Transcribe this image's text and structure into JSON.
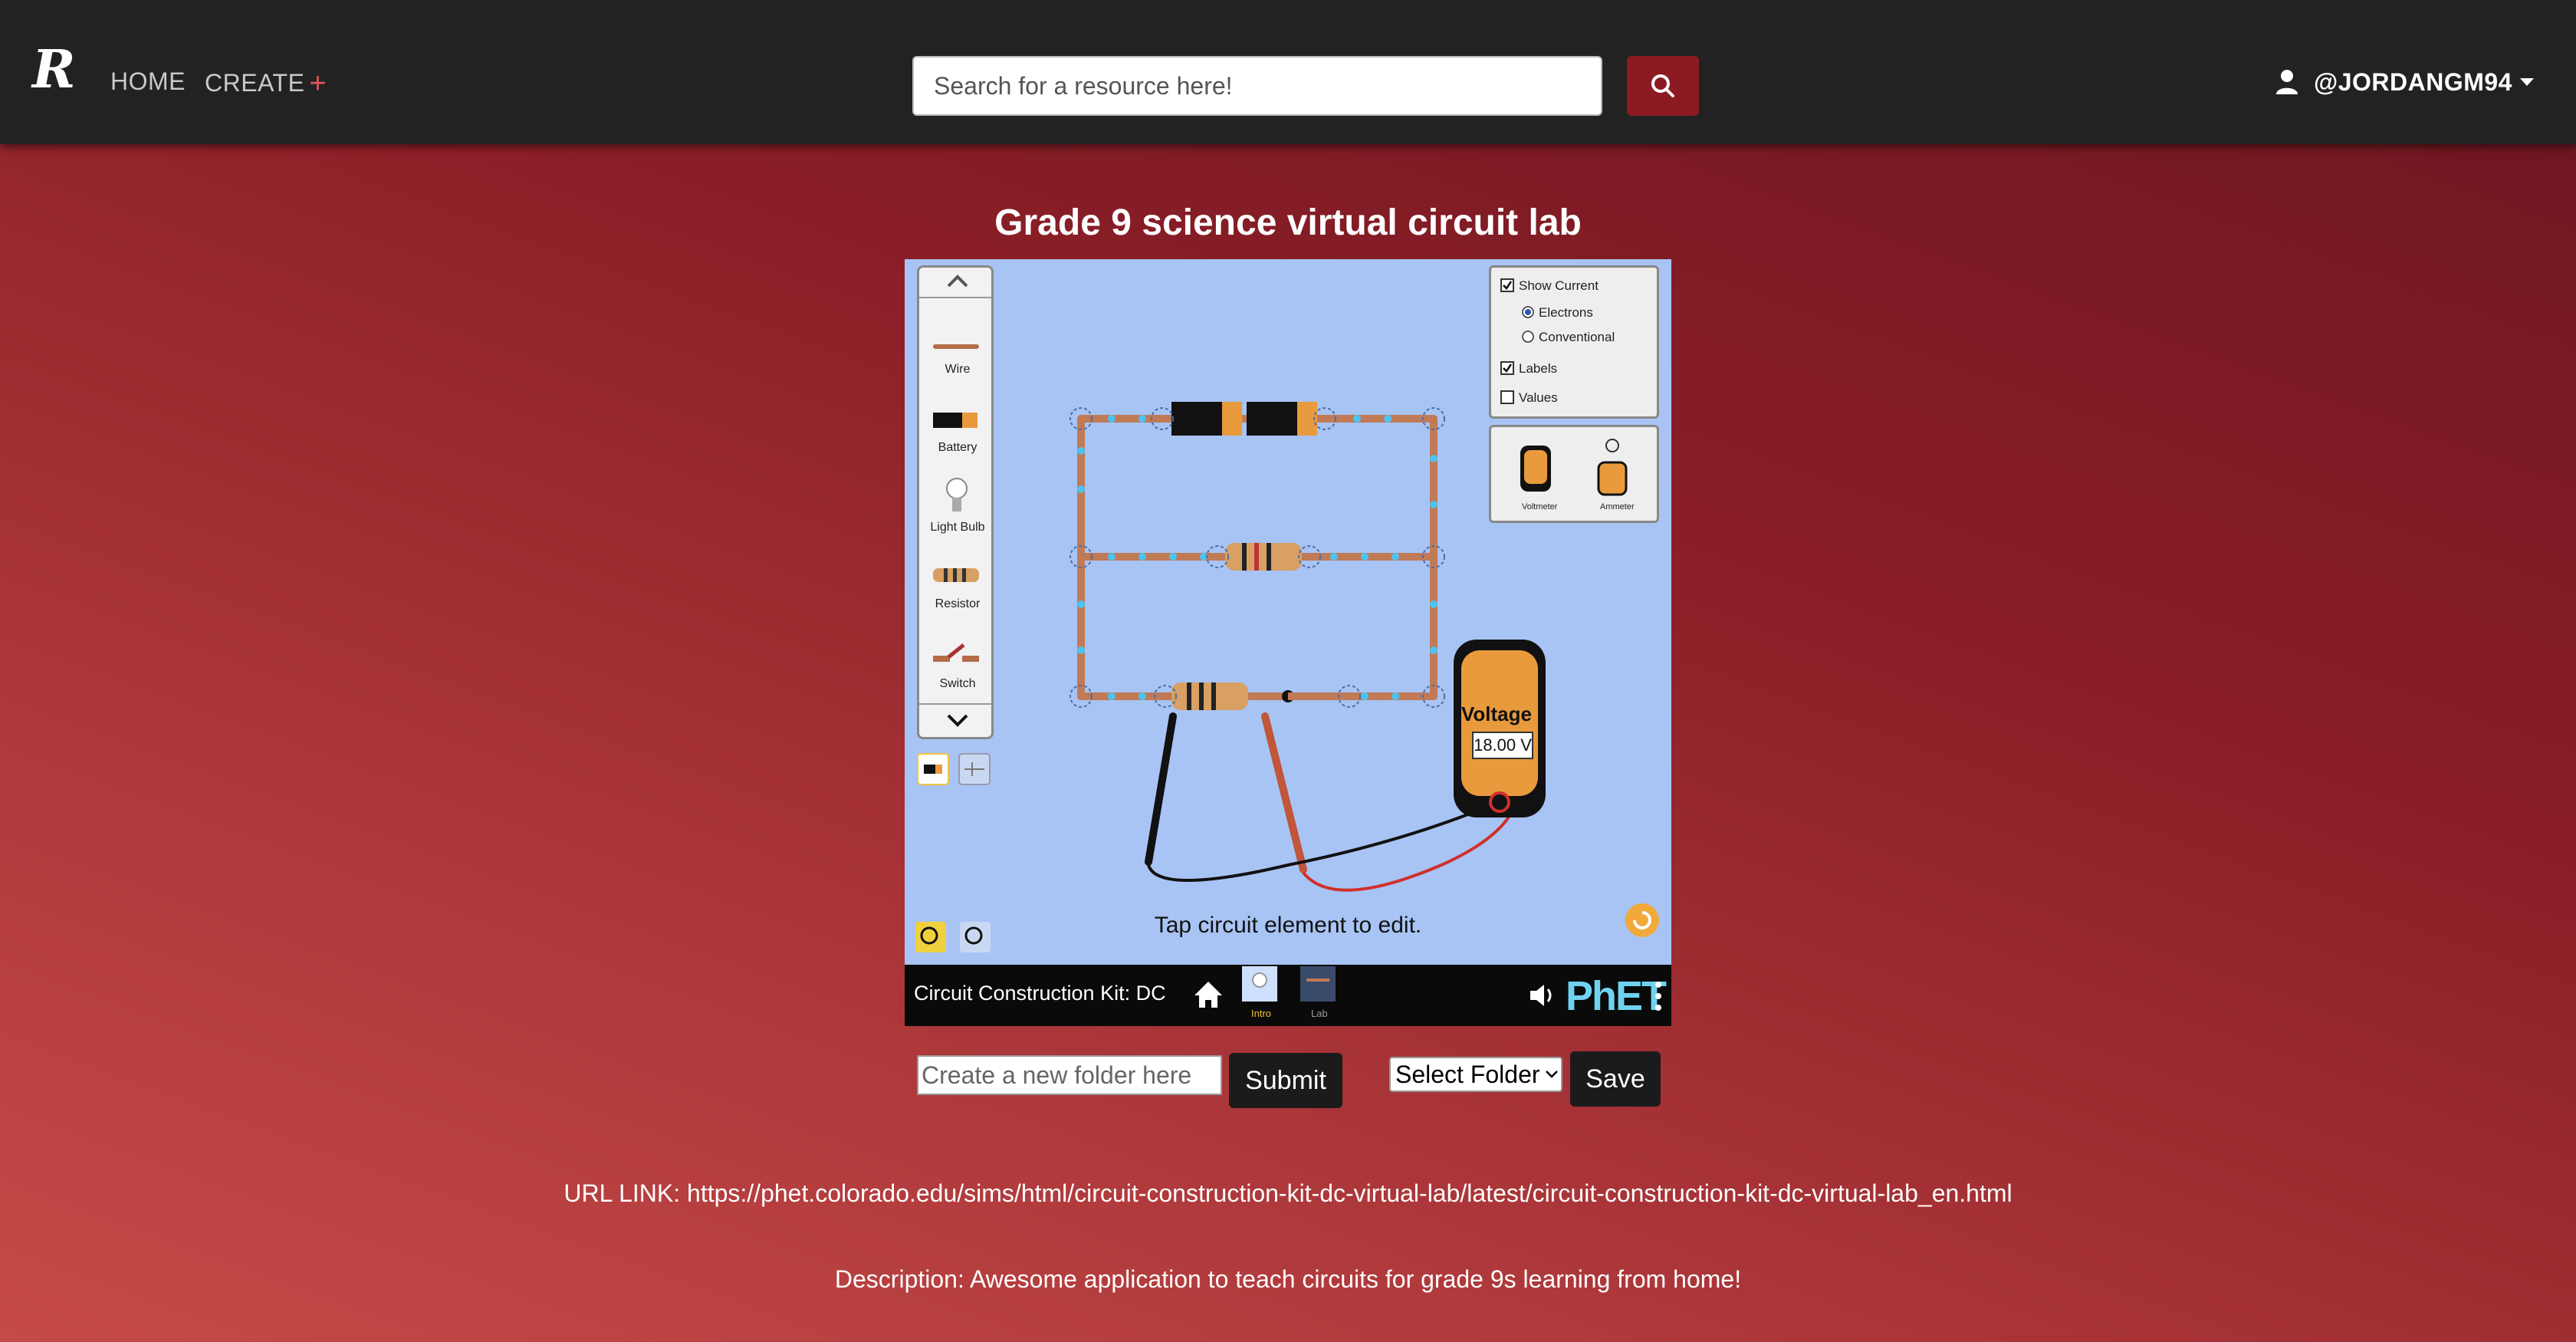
{
  "header": {
    "logo_letter": "R",
    "nav": [
      {
        "label": "HOME"
      },
      {
        "label": "CREATE",
        "suffix": "+"
      }
    ],
    "search": {
      "placeholder": "Search for a resource here!",
      "value": ""
    },
    "user": {
      "handle": "@JORDANGM94"
    }
  },
  "resource": {
    "title": "Grade 9 science virtual circuit lab",
    "url_label": "URL LINK: https://phet.colorado.edu/sims/html/circuit-construction-kit-dc-virtual-lab/latest/circuit-construction-kit-dc-virtual-lab_en.html",
    "description": "Description: Awesome application to teach circuits for grade 9s learning from home!"
  },
  "simulation": {
    "toolbox_items": [
      "Wire",
      "Battery",
      "Light Bulb",
      "Resistor",
      "Switch"
    ],
    "options": {
      "show_current": "Show Current",
      "electrons": "Electrons",
      "conventional": "Conventional",
      "labels": "Labels",
      "values": "Values"
    },
    "meters": {
      "voltmeter": "Voltmeter",
      "ammeter": "Ammeter"
    },
    "voltmeter_title": "Voltage",
    "voltmeter_reading": "18.00 V",
    "hint": "Tap circuit element to edit.",
    "kit_title": "Circuit Construction Kit: DC",
    "screens": [
      "Intro",
      "Lab"
    ],
    "brand": "PhET"
  },
  "folder_controls": {
    "new_folder_placeholder": "Create a new folder here",
    "submit_label": "Submit",
    "select_label": "Select Folder",
    "save_label": "Save"
  },
  "colors": {
    "topbar": "#222222",
    "search_button": "#8b1a22",
    "accent_plus": "#e0555a"
  }
}
